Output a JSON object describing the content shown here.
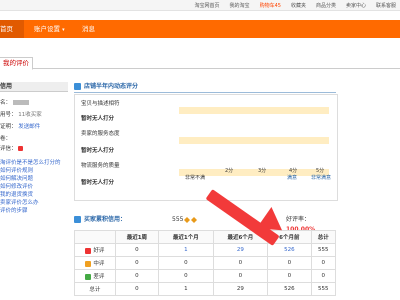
{
  "topbar": {
    "links": [
      "淘宝网首页",
      "我的淘宝",
      "购物车45",
      "收藏夹",
      "商品分类",
      "卖家中心",
      "联系客服"
    ]
  },
  "nav": {
    "home": "首页",
    "account": "账户设置",
    "messages": "消息"
  },
  "subtab": {
    "label": "我的评价"
  },
  "left": {
    "head": "信用",
    "name_label": "名：",
    "level_label": "用号：",
    "level_value": "11收买家",
    "auth_label": "证明：",
    "auth_link": "发送邮件",
    "checkout_label": "卷：",
    "credit_label": "评信：",
    "links": [
      "淘评价是不是怎么打分的",
      "如何评价规则",
      "如何解决问题",
      "如何修改评价",
      "我的退货换货",
      "卖家评价怎么办",
      "评价的步骤"
    ]
  },
  "shop": {
    "title": "店铺半年内动态评分",
    "items": [
      {
        "question": "宝贝与描述相符",
        "value": "暂时无人打分"
      },
      {
        "question": "卖家的服务态度",
        "value": "暂时无人打分"
      },
      {
        "question": "物流服务的质量",
        "value": "暂时无人打分"
      }
    ],
    "scale_numbers": [
      "2分",
      "3分",
      "4分",
      "5分"
    ],
    "scale_labels": [
      "非常不满",
      "满意",
      "非常满意"
    ]
  },
  "buyer": {
    "label": "买家累积信用：",
    "score": "555",
    "good_rate_label": "好评率：",
    "good_rate": "100.00%"
  },
  "table": {
    "headers": [
      "",
      "最近1周",
      "最近1个月",
      "最近6个月",
      "6个月前",
      "总计"
    ],
    "rows": [
      {
        "label": "好评",
        "values": [
          "0",
          "1",
          "29",
          "526",
          "555"
        ]
      },
      {
        "label": "中评",
        "values": [
          "0",
          "0",
          "0",
          "0",
          "0"
        ]
      },
      {
        "label": "差评",
        "values": [
          "0",
          "0",
          "0",
          "0",
          "0"
        ]
      },
      {
        "label": "总计",
        "values": [
          "0",
          "1",
          "29",
          "526",
          "555"
        ]
      }
    ]
  },
  "colors": {
    "nav": "#ff6a00",
    "rating_bar": "#ffedc2",
    "arrow": "#f23a3a",
    "link": "#3366cc"
  }
}
